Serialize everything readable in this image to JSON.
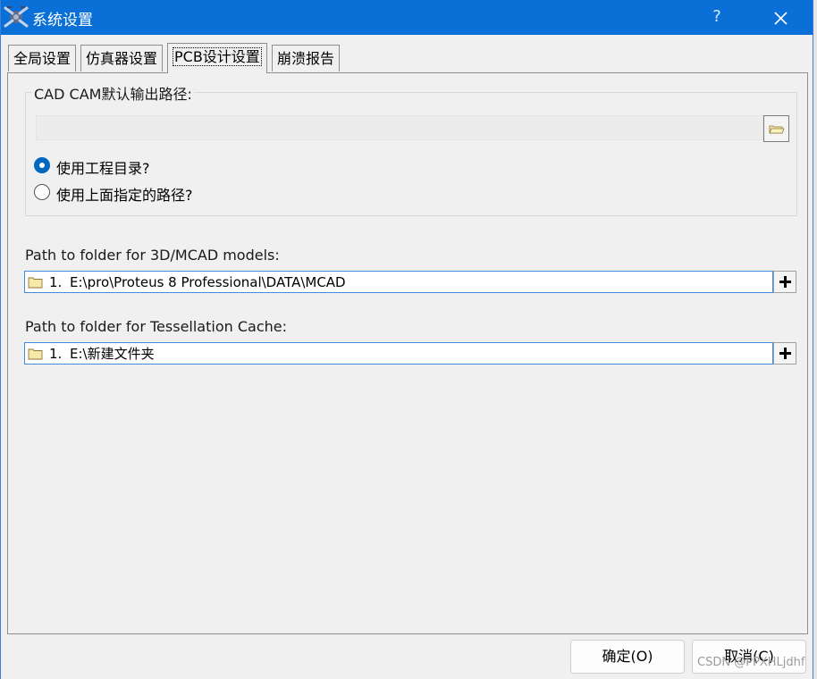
{
  "window": {
    "title": "系统设置",
    "help_label": "?",
    "accent_color": "#0a6fd6"
  },
  "tabs": [
    {
      "label": "全局设置",
      "active": false
    },
    {
      "label": "仿真器设置",
      "active": false
    },
    {
      "label": "PCB设计设置",
      "active": true
    },
    {
      "label": "崩溃报告",
      "active": false
    }
  ],
  "cadcam": {
    "legend": "CAD CAM默认输出路径:",
    "path_value": "",
    "options": [
      {
        "label": "使用工程目录?",
        "checked": true
      },
      {
        "label": "使用上面指定的路径?",
        "checked": false
      }
    ]
  },
  "mcad": {
    "label": "Path to folder for 3D/MCAD models:",
    "entries": [
      {
        "index": "1.",
        "path": "E:\\pro\\Proteus 8 Professional\\DATA\\MCAD"
      }
    ]
  },
  "tessellation": {
    "label": "Path to folder for Tessellation Cache:",
    "entries": [
      {
        "index": "1.",
        "path": "E:\\新建文件夹"
      }
    ]
  },
  "buttons": {
    "ok": "确定(O)",
    "cancel": "取消(C)"
  },
  "watermark": "CSDN @PPXHLjdhf"
}
